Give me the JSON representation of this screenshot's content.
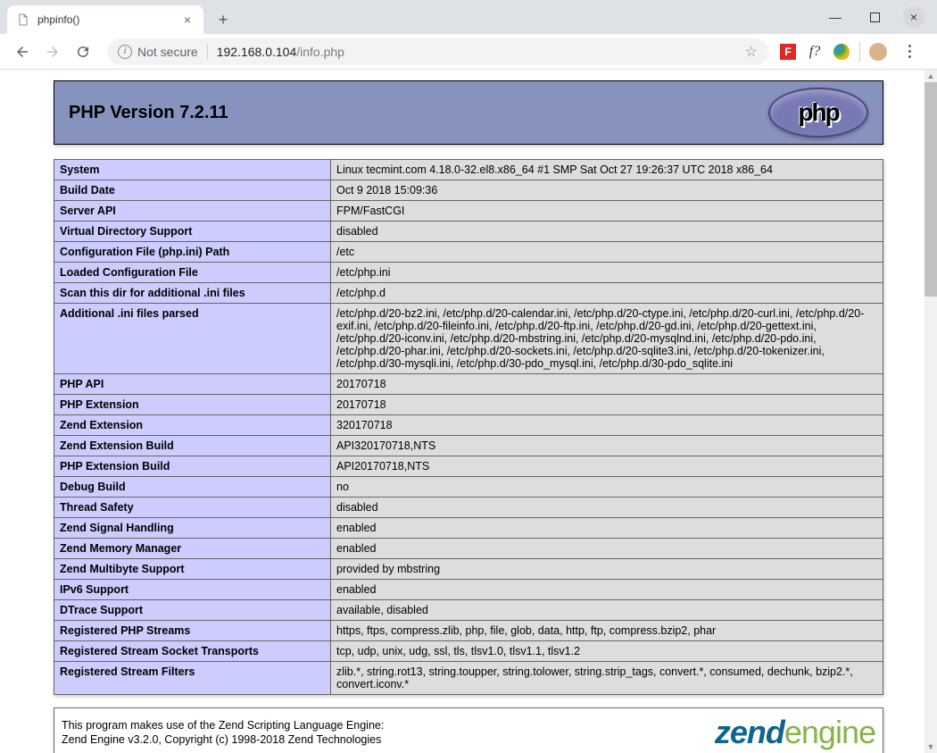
{
  "browser": {
    "tab_title": "phpinfo()",
    "not_secure": "Not secure",
    "url_host": "192.168.0.104",
    "url_path": "/info.php"
  },
  "header": {
    "title": "PHP Version 7.2.11",
    "logo_text": "php"
  },
  "rows": [
    {
      "k": "System",
      "v": "Linux tecmint.com 4.18.0-32.el8.x86_64 #1 SMP Sat Oct 27 19:26:37 UTC 2018 x86_64"
    },
    {
      "k": "Build Date",
      "v": "Oct 9 2018 15:09:36"
    },
    {
      "k": "Server API",
      "v": "FPM/FastCGI"
    },
    {
      "k": "Virtual Directory Support",
      "v": "disabled"
    },
    {
      "k": "Configuration File (php.ini) Path",
      "v": "/etc"
    },
    {
      "k": "Loaded Configuration File",
      "v": "/etc/php.ini"
    },
    {
      "k": "Scan this dir for additional .ini files",
      "v": "/etc/php.d"
    },
    {
      "k": "Additional .ini files parsed",
      "v": "/etc/php.d/20-bz2.ini, /etc/php.d/20-calendar.ini, /etc/php.d/20-ctype.ini, /etc/php.d/20-curl.ini, /etc/php.d/20-exif.ini, /etc/php.d/20-fileinfo.ini, /etc/php.d/20-ftp.ini, /etc/php.d/20-gd.ini, /etc/php.d/20-gettext.ini, /etc/php.d/20-iconv.ini, /etc/php.d/20-mbstring.ini, /etc/php.d/20-mysqlnd.ini, /etc/php.d/20-pdo.ini, /etc/php.d/20-phar.ini, /etc/php.d/20-sockets.ini, /etc/php.d/20-sqlite3.ini, /etc/php.d/20-tokenizer.ini, /etc/php.d/30-mysqli.ini, /etc/php.d/30-pdo_mysql.ini, /etc/php.d/30-pdo_sqlite.ini"
    },
    {
      "k": "PHP API",
      "v": "20170718"
    },
    {
      "k": "PHP Extension",
      "v": "20170718"
    },
    {
      "k": "Zend Extension",
      "v": "320170718"
    },
    {
      "k": "Zend Extension Build",
      "v": "API320170718,NTS"
    },
    {
      "k": "PHP Extension Build",
      "v": "API20170718,NTS"
    },
    {
      "k": "Debug Build",
      "v": "no"
    },
    {
      "k": "Thread Safety",
      "v": "disabled"
    },
    {
      "k": "Zend Signal Handling",
      "v": "enabled"
    },
    {
      "k": "Zend Memory Manager",
      "v": "enabled"
    },
    {
      "k": "Zend Multibyte Support",
      "v": "provided by mbstring"
    },
    {
      "k": "IPv6 Support",
      "v": "enabled"
    },
    {
      "k": "DTrace Support",
      "v": "available, disabled"
    },
    {
      "k": "Registered PHP Streams",
      "v": "https, ftps, compress.zlib, php, file, glob, data, http, ftp, compress.bzip2, phar"
    },
    {
      "k": "Registered Stream Socket Transports",
      "v": "tcp, udp, unix, udg, ssl, tls, tlsv1.0, tlsv1.1, tlsv1.2"
    },
    {
      "k": "Registered Stream Filters",
      "v": "zlib.*, string.rot13, string.toupper, string.tolower, string.strip_tags, convert.*, consumed, dechunk, bzip2.*, convert.iconv.*"
    }
  ],
  "zend": {
    "line1": "This program makes use of the Zend Scripting Language Engine:",
    "line2": "Zend Engine v3.2.0, Copyright (c) 1998-2018 Zend Technologies",
    "logo1": "zend",
    "logo2": "engine"
  }
}
